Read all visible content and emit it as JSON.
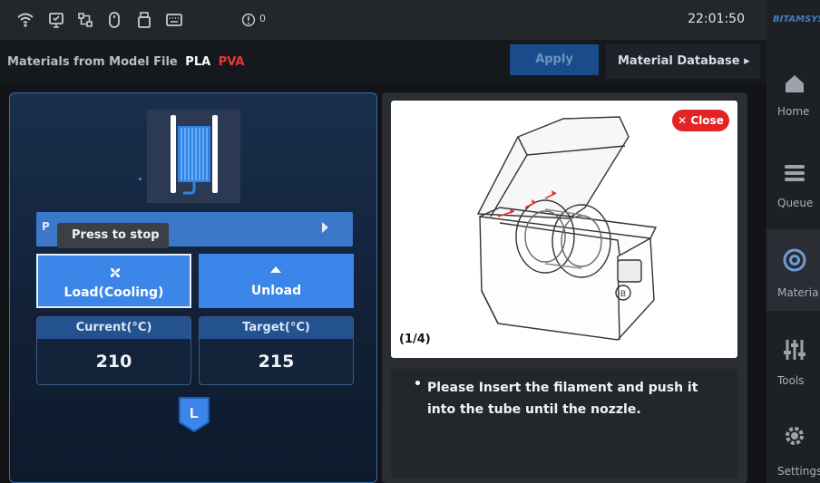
{
  "statusbar": {
    "icons": [
      "wifi-icon",
      "monitor-icon",
      "network-icon",
      "mouse-icon",
      "usb-drive-icon",
      "keyboard-icon",
      "info-icon"
    ],
    "notification_count": "0",
    "time": "22:01:50"
  },
  "materials": {
    "label": "Materials from Model File",
    "items": [
      "PLA",
      "PVA"
    ],
    "item_colors": [
      "#ffffff",
      "#e53939"
    ],
    "apply_label": "Apply",
    "database_label": "Material Database ▸"
  },
  "sidebar": {
    "brand": "BITAMSYS",
    "items": [
      {
        "label": "Home",
        "icon": "home-icon"
      },
      {
        "label": "Queue",
        "icon": "queue-icon"
      },
      {
        "label": "Materia",
        "icon": "material-icon"
      },
      {
        "label": "Tools",
        "icon": "tools-icon"
      },
      {
        "label": "Settings",
        "icon": "gear-icon"
      }
    ]
  },
  "load_panel": {
    "select_letter": "P",
    "tooltip": "Press to stop",
    "load_label": "Load(Cooling)",
    "unload_label": "Unload",
    "current_label": "Current(°C)",
    "target_label": "Target(°C)",
    "current_value": "210",
    "target_value": "215",
    "badge_letter": "L"
  },
  "guide": {
    "close_label": "✕ Close",
    "step": "(1/4)",
    "bullet": "•",
    "text": "Please Insert the filament and push it into the tube until the nozzle."
  },
  "colors": {
    "accent": "#3b86e8",
    "close": "#e42424",
    "panel_border": "#3d6aa7"
  }
}
